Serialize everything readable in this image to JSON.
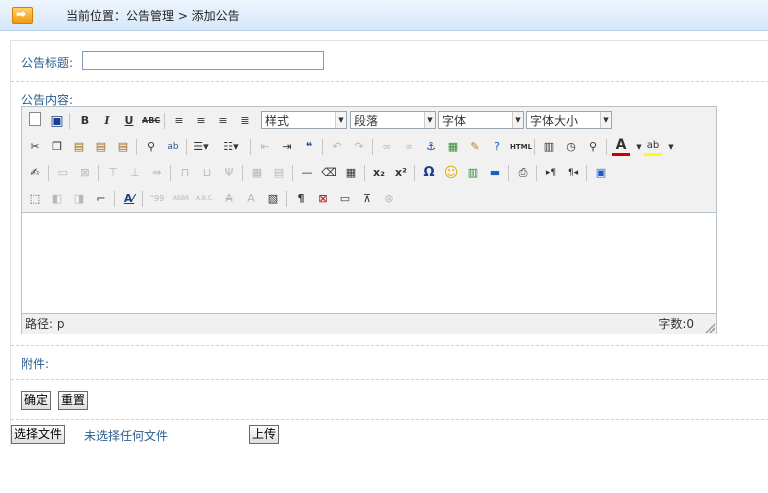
{
  "breadcrumb": "当前位置：公告管理 > 添加公告",
  "form": {
    "title_label": "公告标题:",
    "title_value": "",
    "content_label": "公告内容:",
    "attachment_label": "附件:",
    "confirm_button": "确定",
    "reset_button": "重置",
    "choose_file_button": "选择文件",
    "no_file_text": "未选择任何文件",
    "upload_button": "上传"
  },
  "editor": {
    "style_select": "样式",
    "paragraph_select": "段落",
    "font_select": "字体",
    "size_select": "字体大小",
    "path_label": "路径: p",
    "word_count": "字数:0",
    "content": ""
  },
  "toolbar_icons": {
    "row1": [
      "new-document",
      "save",
      "bold",
      "italic",
      "underline",
      "strikethrough",
      "align-left",
      "align-center",
      "align-right",
      "justify"
    ],
    "row2": [
      "cut",
      "copy",
      "paste",
      "paste-text",
      "paste-word",
      "find",
      "replace",
      "bullet-list",
      "numbered-list",
      "outdent",
      "indent",
      "blockquote",
      "undo",
      "redo",
      "link",
      "unlink",
      "anchor",
      "image",
      "cleanup",
      "help",
      "html-source",
      "insert-date",
      "insert-time",
      "preview",
      "font-color",
      "highlight-color"
    ],
    "row3": [
      "table",
      "delete-row",
      "delete-col",
      "insert-row",
      "insert-col",
      "delete",
      "merge",
      "split",
      "row-props",
      "cell-props",
      "hr",
      "remove-format",
      "visual-aid",
      "subscript",
      "superscript",
      "special-char",
      "emoticon",
      "media",
      "advanced-hr",
      "print",
      "ltr",
      "rtl",
      "fullscreen"
    ],
    "row4": [
      "select-all",
      "insert-layer",
      "move-forward",
      "absolute",
      "style-props",
      "cite",
      "abbr",
      "acronym",
      "del",
      "ins",
      "attribs",
      "show-blocks",
      "nonbreaking",
      "pagebreak",
      "template"
    ]
  },
  "colors": {
    "label": "#2a5d8f",
    "topbar": "#d6e7f8",
    "arrow": "#f29a12",
    "font_color_bar": "#cc0000",
    "highlight_bar": "#ffff00"
  }
}
